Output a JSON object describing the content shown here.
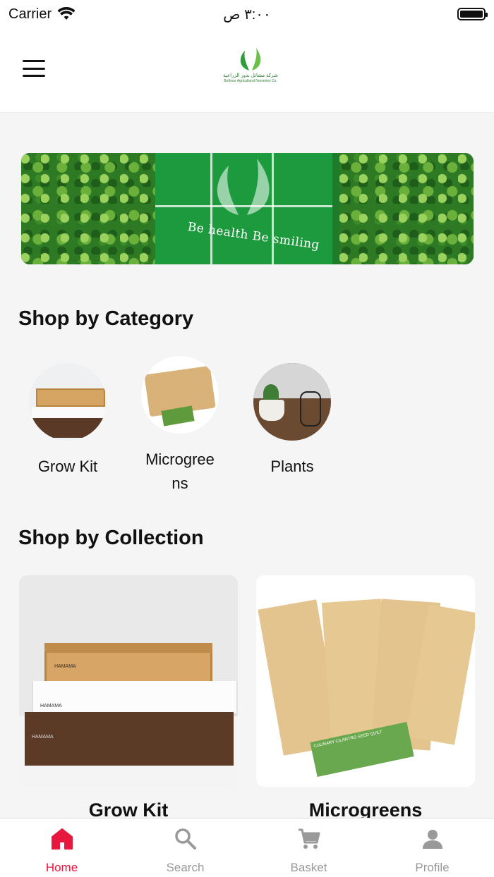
{
  "status": {
    "carrier": "Carrier",
    "time": "٣:٠٠ ص"
  },
  "header": {
    "logo_text": "شركة مشاتل بذور الزراعية",
    "logo_sub": "Bothour Agricultural Nurseries Co."
  },
  "banner": {
    "slogan": "Be health Be smiling"
  },
  "categories": {
    "title": "Shop by Category",
    "items": [
      {
        "label": "Grow Kit"
      },
      {
        "label": "Microgreens"
      },
      {
        "label": "Plants"
      }
    ]
  },
  "collections": {
    "title": "Shop by Collection",
    "items": [
      {
        "label": "Grow Kit",
        "brand": "HAMAMA"
      },
      {
        "label": "Microgreens",
        "seed_quilt": "CULINARY CILANTRO SEED QUILT"
      }
    ]
  },
  "tabbar": {
    "active_color": "#e8173d",
    "items": [
      {
        "label": "Home",
        "icon": "home-icon"
      },
      {
        "label": "Search",
        "icon": "search-icon"
      },
      {
        "label": "Basket",
        "icon": "cart-icon"
      },
      {
        "label": "Profile",
        "icon": "profile-icon"
      }
    ]
  }
}
